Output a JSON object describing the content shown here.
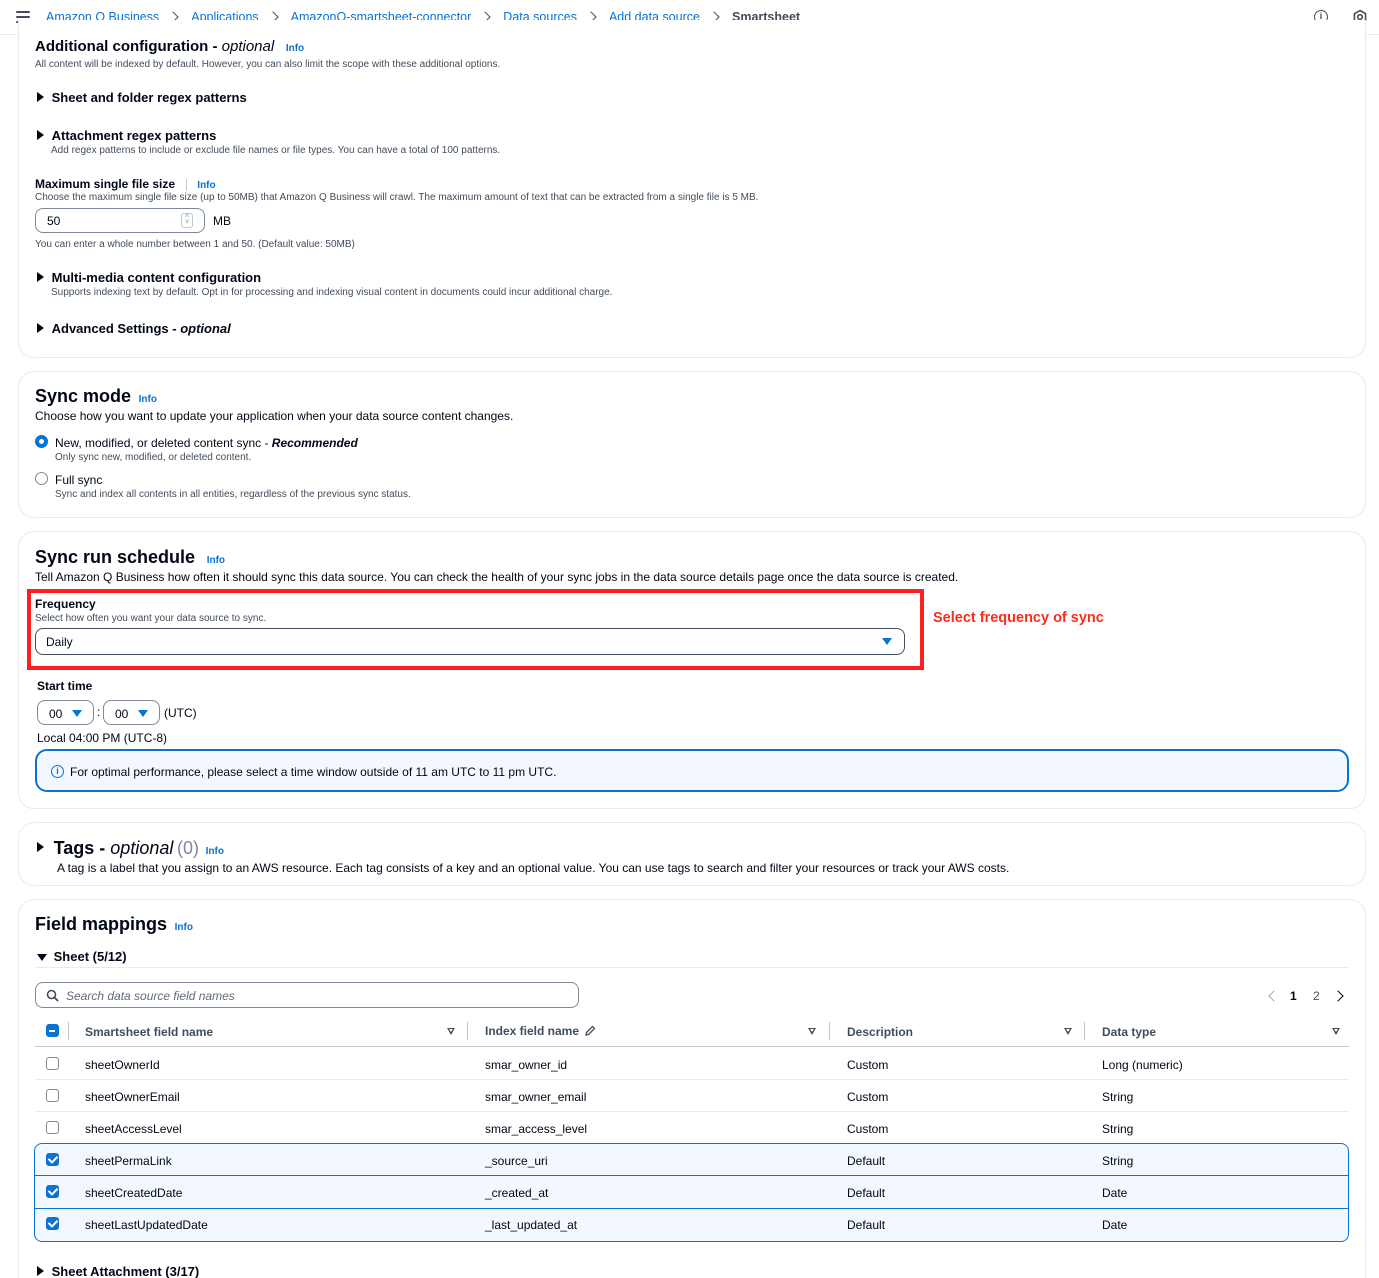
{
  "breadcrumbs": [
    "Amazon Q Business",
    "Applications",
    "AmazonQ-smartsheet-connector",
    "Data sources",
    "Add data source"
  ],
  "breadcrumb_current": "Smartsheet",
  "info_label": "Info",
  "additional": {
    "title": "Additional configuration - ",
    "title_optional": "optional",
    "desc": "All content will be indexed by default. However, you can also limit the scope with these additional options.",
    "sheet_regex": "Sheet and folder regex patterns",
    "attach_regex": "Attachment regex patterns",
    "attach_regex_desc": "Add regex patterns to include or exclude file names or file types. You can have a total of 100 patterns.",
    "max_size_label": "Maximum single file size",
    "max_size_desc": "Choose the maximum single file size (up to 50MB) that Amazon Q Business will crawl. The maximum amount of text that can be extracted from a single file is 5 MB.",
    "max_size_value": "50",
    "max_size_unit": "MB",
    "max_size_hint": "You can enter a whole number between 1 and 50. (Default value: 50MB)",
    "multimedia": "Multi-media content configuration",
    "multimedia_desc": "Supports indexing text by default. Opt in for processing and indexing visual content in documents could incur additional charge.",
    "advanced": "Advanced Settings - ",
    "advanced_optional": "optional"
  },
  "sync_mode": {
    "title": "Sync mode",
    "desc": "Choose how you want to update your application when your data source content changes.",
    "opt1_label": "New, modified, or deleted content sync - ",
    "opt1_recommended": "Recommended",
    "opt1_desc": "Only sync new, modified, or deleted content.",
    "opt1_selected": true,
    "opt2_label": "Full sync",
    "opt2_desc": "Sync and index all contents in all entities, regardless of the previous sync status.",
    "opt2_selected": false
  },
  "schedule": {
    "title": "Sync run schedule",
    "desc": "Tell Amazon Q Business how often it should sync this data source. You can check the health of your sync jobs in the data source details page once the data source is created.",
    "freq_label": "Frequency",
    "freq_desc": "Select how often you want your data source to sync.",
    "freq_value": "Daily",
    "annotation": "Select frequency of sync",
    "start_label": "Start time",
    "hour": "00",
    "minute": "00",
    "colon": ":",
    "tz": "(UTC)",
    "local": "Local 04:00 PM (UTC-8)",
    "alert": "For optimal performance, please select a time window outside of 11 am UTC to 11 pm UTC."
  },
  "tags": {
    "title": "Tags - ",
    "optional": "optional",
    "count": "(0)",
    "desc": "A tag is a label that you assign to an AWS resource. Each tag consists of a key and an optional value. You can use tags to search and filter your resources or track your AWS costs."
  },
  "field_mappings": {
    "title": "Field mappings",
    "sheet_section": "Sheet (5/12)",
    "search_placeholder": "Search data source field names",
    "pages": [
      "1",
      "2"
    ],
    "current_page": "1",
    "columns": [
      "Smartsheet field name",
      "Index field name",
      "Description",
      "Data type"
    ],
    "rows": [
      {
        "field": "sheetOwnerId",
        "index": "smar_owner_id",
        "desc": "Custom",
        "type": "Long (numeric)",
        "checked": false
      },
      {
        "field": "sheetOwnerEmail",
        "index": "smar_owner_email",
        "desc": "Custom",
        "type": "String",
        "checked": false
      },
      {
        "field": "sheetAccessLevel",
        "index": "smar_access_level",
        "desc": "Custom",
        "type": "String",
        "checked": false
      },
      {
        "field": "sheetPermaLink",
        "index": "_source_uri",
        "desc": "Default",
        "type": "String",
        "checked": true
      },
      {
        "field": "sheetCreatedDate",
        "index": "_created_at",
        "desc": "Default",
        "type": "Date",
        "checked": true
      },
      {
        "field": "sheetLastUpdatedDate",
        "index": "_last_updated_at",
        "desc": "Default",
        "type": "Date",
        "checked": true
      }
    ],
    "attachment_section": "Sheet Attachment (3/17)"
  },
  "colors": {
    "link": "#0972d3",
    "text": "#000716",
    "annotation_red": "#ff1f1f",
    "selected_bg": "#f2f8fd"
  },
  "icons": [
    "menu-icon",
    "info-circle-icon",
    "settings-icon",
    "search-icon",
    "pencil-icon",
    "chevron-left-icon",
    "chevron-right-icon"
  ]
}
